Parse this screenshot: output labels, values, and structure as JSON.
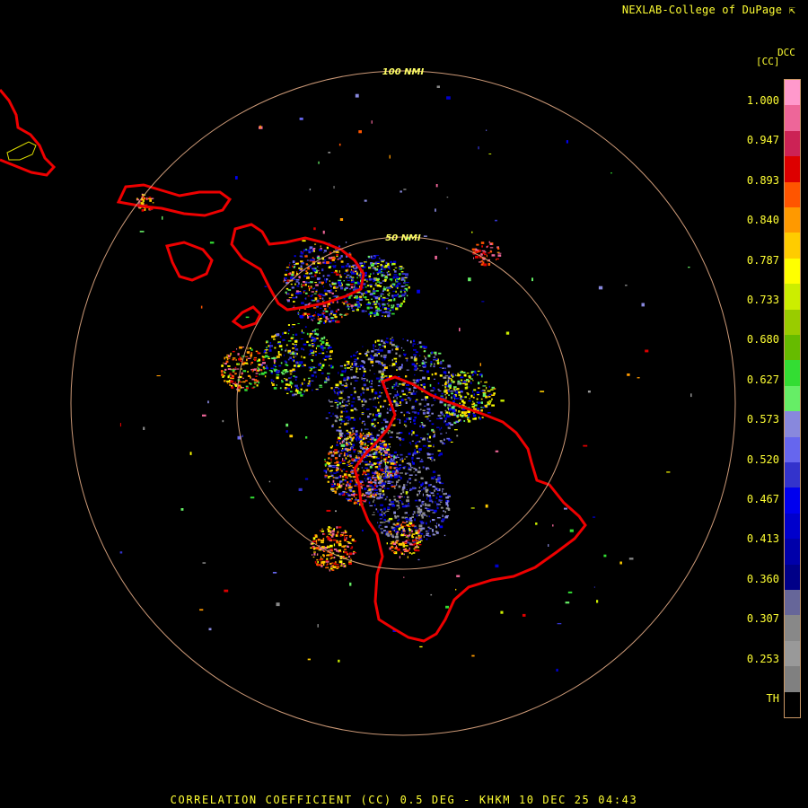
{
  "header": {
    "credit": "NEXLAB-College of DuPage",
    "credit_icon": "external-link-icon"
  },
  "footer": {
    "caption": "CORRELATION COEFFICIENT (CC) 0.5 DEG - KHKM 10 DEC 25 04:43"
  },
  "legend": {
    "product_code": "DCC",
    "unit": "[CC]",
    "ticks": [
      "1.000",
      "0.947",
      "0.893",
      "0.840",
      "0.787",
      "0.733",
      "0.680",
      "0.627",
      "0.573",
      "0.520",
      "0.467",
      "0.413",
      "0.360",
      "0.307",
      "0.253",
      "TH"
    ],
    "colors": [
      "#ff99cc",
      "#ee6699",
      "#cc2255",
      "#dd0000",
      "#ff5500",
      "#ff9900",
      "#ffcc00",
      "#ffff00",
      "#ccee00",
      "#99cc00",
      "#66bb00",
      "#33dd33",
      "#66ee66",
      "#8888dd",
      "#6666ee",
      "#3333cc",
      "#0000ee",
      "#0000cc",
      "#0000aa",
      "#000088",
      "#666699",
      "#888888",
      "#999999",
      "#808080",
      "#000000"
    ]
  },
  "map": {
    "range_rings": [
      {
        "label": "100 NMI",
        "range_nmi": 100
      },
      {
        "label": "50 NMI",
        "range_nmi": 50
      }
    ],
    "coastline_color": "#ee0000",
    "ring_color": "#cc9977",
    "radar_site": "KHKM"
  }
}
